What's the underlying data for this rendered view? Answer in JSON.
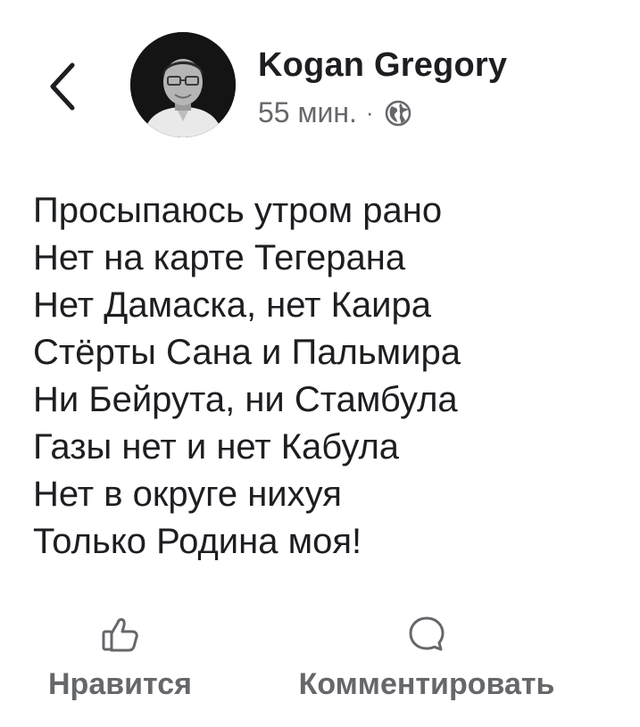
{
  "header": {
    "back_icon": "chevron-left-icon",
    "author_name": "Kogan Gregory",
    "time": "55 мин.",
    "separator": "·",
    "privacy_icon": "globe-icon"
  },
  "post": {
    "lines": [
      "Просыпаюсь утром рано",
      "Нет на карте Тегерана",
      "Нет Дамаска, нет Каира",
      "Стёрты Сана и Пальмира",
      "Ни Бейрута, ни Стамбула",
      "Газы нет и нет Кабула",
      "Нет в округе нихуя",
      "Только Родина моя!"
    ]
  },
  "actions": {
    "like_label": "Нравится",
    "like_icon": "thumbs-up-icon",
    "comment_label": "Комментировать",
    "comment_icon": "comment-bubble-icon"
  },
  "colors": {
    "text": "#1c1e21",
    "secondary": "#65676b",
    "background": "#ffffff"
  }
}
